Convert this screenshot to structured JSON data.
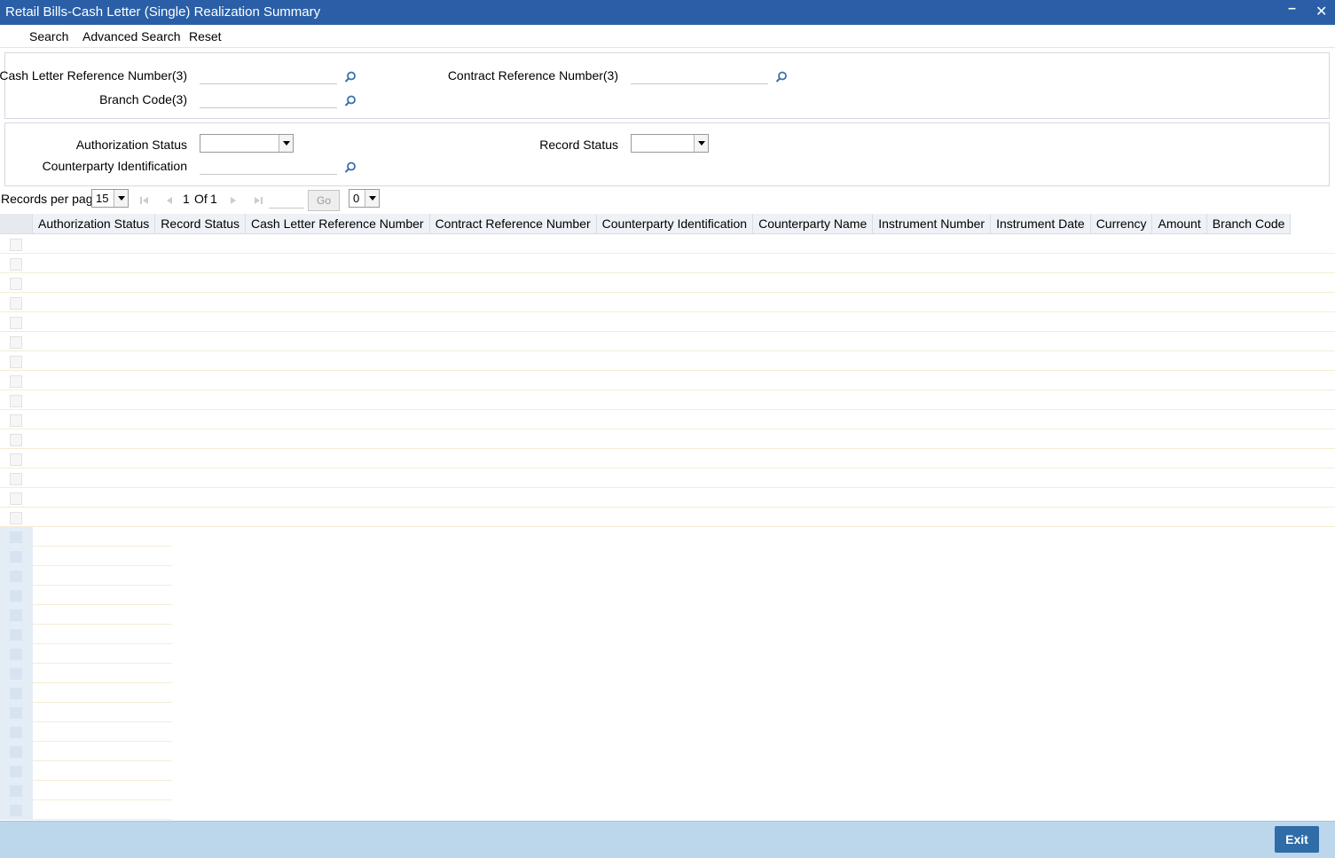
{
  "window": {
    "title": "Retail Bills-Cash Letter (Single) Realization Summary",
    "minimize_glyph": "–",
    "close_glyph": "✕"
  },
  "menu": {
    "search": "Search",
    "advanced_search": "Advanced Search",
    "reset": "Reset"
  },
  "search_panel": {
    "cash_letter_ref_label": "Cash Letter Reference Number(3)",
    "cash_letter_ref_value": "",
    "contract_ref_label": "Contract Reference Number(3)",
    "contract_ref_value": "",
    "branch_code_label": "Branch Code(3)",
    "branch_code_value": ""
  },
  "filter_panel": {
    "auth_status_label": "Authorization Status",
    "auth_status_value": "",
    "record_status_label": "Record Status",
    "record_status_value": "",
    "counterparty_label": "Counterparty Identification",
    "counterparty_value": ""
  },
  "pager": {
    "records_per_page_label": "Records per page",
    "records_per_page_value": "15",
    "current_page": "1",
    "of_label": "Of",
    "total_pages": "1",
    "goto_value": "",
    "go_label": "Go",
    "extra_select_value": "0"
  },
  "grid": {
    "columns": [
      "Authorization Status",
      "Record Status",
      "Cash Letter Reference Number",
      "Contract Reference Number",
      "Counterparty Identification",
      "Counterparty Name",
      "Instrument Number",
      "Instrument Date",
      "Currency",
      "Amount",
      "Branch Code"
    ],
    "row_count": 15,
    "lower_row_count": 15
  },
  "footer": {
    "exit_label": "Exit"
  },
  "colors": {
    "title_bar": "#2a5fa7",
    "footer": "#bcd6ec",
    "exit_button": "#2f6ca8"
  },
  "icons": {
    "lookup": "magnifier-icon",
    "first": "first-page-icon",
    "prev": "prev-page-icon",
    "next": "next-page-icon",
    "last": "last-page-icon"
  }
}
